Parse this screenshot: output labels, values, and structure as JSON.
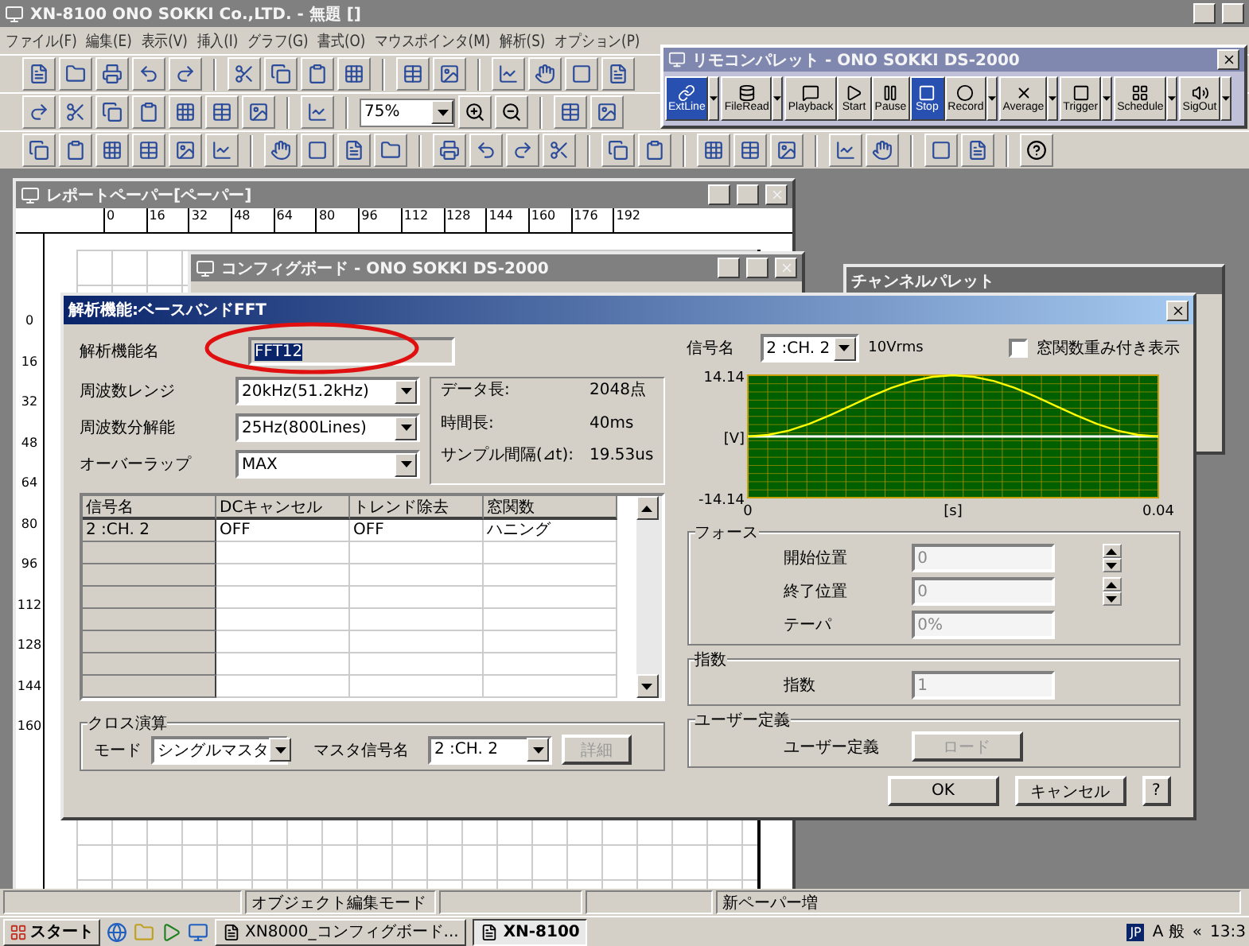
{
  "app": {
    "title": "XN-8100 ONO SOKKI Co.,LTD. - 無題 []",
    "menu": [
      "ファイル(F)",
      "編集(E)",
      "表示(V)",
      "挿入(I)",
      "グラフ(G)",
      "書式(O)",
      "マウスポインタ(M)",
      "解析(S)",
      "オプション(P)"
    ]
  },
  "toolbar": {
    "zoom": "75%"
  },
  "remote_palette": {
    "title": "リモコンパレット - ONO SOKKI DS-2000",
    "buttons": [
      {
        "label": "ExtLine",
        "kind": "link",
        "selected": true,
        "dropdown": true
      },
      {
        "label": "FileRead",
        "kind": "file",
        "selected": false,
        "dropdown": true
      },
      {
        "label": "Playback",
        "kind": "playback",
        "selected": false,
        "dropdown": false
      },
      {
        "label": "Start",
        "kind": "play",
        "selected": false,
        "dropdown": false
      },
      {
        "label": "Pause",
        "kind": "pause",
        "selected": false,
        "dropdown": false
      },
      {
        "label": "Stop",
        "kind": "stop",
        "selected": true,
        "dropdown": false
      },
      {
        "label": "Record",
        "kind": "record",
        "selected": false,
        "dropdown": true
      },
      {
        "label": "Average",
        "kind": "average",
        "selected": false,
        "dropdown": true
      },
      {
        "label": "Trigger",
        "kind": "trigger",
        "selected": false,
        "dropdown": true
      },
      {
        "label": "Schedule",
        "kind": "schedule",
        "selected": false,
        "dropdown": true
      },
      {
        "label": "SigOut",
        "kind": "sigout",
        "selected": false,
        "dropdown": true
      }
    ]
  },
  "report_paper": {
    "title": "レポートペーパー[ペーパー]",
    "ruler": [
      "0",
      "16",
      "32",
      "48",
      "64",
      "80",
      "96",
      "112",
      "128",
      "144",
      "160",
      "176",
      "192"
    ],
    "vertical_ruler": [
      "0",
      "16",
      "32",
      "48",
      "64",
      "80",
      "96",
      "112",
      "128",
      "144",
      "160"
    ]
  },
  "config_board": {
    "title": "コンフィグボード - ONO SOKKI DS-2000"
  },
  "channel_palette": {
    "title": "チャンネルパレット"
  },
  "dialog": {
    "title": "解析機能:ベースバンドFFT",
    "name_label": "解析機能名",
    "name_value": "FFT12",
    "fields": [
      {
        "label": "周波数レンジ",
        "value": "20kHz(51.2kHz)"
      },
      {
        "label": "周波数分解能",
        "value": "25Hz(800Lines)"
      },
      {
        "label": "オーバーラップ",
        "value": "MAX"
      }
    ],
    "info": [
      {
        "label": "データ長:",
        "value": "2048点"
      },
      {
        "label": "時間長:",
        "value": "40ms"
      },
      {
        "label": "サンプル間隔(⊿t):",
        "value": "19.53us"
      }
    ],
    "table": {
      "columns": [
        "信号名",
        "DCキャンセル",
        "トレンド除去",
        "窓関数"
      ],
      "rows": [
        [
          "2 :CH. 2",
          "OFF",
          "OFF",
          "ハニング"
        ]
      ]
    },
    "cross": {
      "title": "クロス演算",
      "mode_label": "モード",
      "mode": "シングルマスタ",
      "master_label": "マスタ信号名",
      "master": "2 :CH. 2",
      "detail": "詳細",
      "detail_disabled": true
    },
    "signal_label": "信号名",
    "signal": "2 :CH. 2",
    "unit": "10Vrms",
    "weight": {
      "label": "窓関数重み付き表示",
      "checked": false
    },
    "chart_data": {
      "type": "line",
      "xlabel": "[s]",
      "ylabel": "[V]",
      "x": [
        0,
        0.002,
        0.004,
        0.006,
        0.008,
        0.01,
        0.012,
        0.014,
        0.016,
        0.018,
        0.02,
        0.022,
        0.024,
        0.026,
        0.028,
        0.03,
        0.032,
        0.034,
        0.036,
        0.038,
        0.04
      ],
      "series": [
        {
          "color": "#ffff00",
          "values": [
            0,
            0.35,
            1.35,
            2.91,
            4.89,
            7.07,
            9.25,
            11.23,
            12.79,
            13.79,
            14.14,
            13.79,
            12.79,
            11.23,
            9.25,
            7.07,
            4.89,
            2.91,
            1.35,
            0.35,
            0
          ]
        }
      ],
      "xlim": [
        0,
        0.04
      ],
      "ylim": [
        -14.14,
        14.14
      ],
      "xticks": [
        {
          "value": 0,
          "label": "0"
        },
        {
          "value": 0.04,
          "label": "0.04"
        }
      ],
      "yticks": [
        {
          "value": -14.14,
          "label": "-14.14"
        },
        {
          "value": 14.14,
          "label": "14.14"
        }
      ]
    },
    "force": {
      "title": "フォース",
      "fields": [
        {
          "label": "開始位置",
          "value": "0",
          "spin": true,
          "disabled": true
        },
        {
          "label": "終了位置",
          "value": "0",
          "spin": true,
          "disabled": true
        },
        {
          "label": "テーパ",
          "value": "0%",
          "spin": false,
          "disabled": true
        }
      ]
    },
    "exponent": {
      "title": "指数",
      "label": "指数",
      "value": "1",
      "disabled": true
    },
    "user": {
      "title": "ユーザー定義",
      "label": "ユーザー定義",
      "button": "ロード",
      "disabled": true
    },
    "buttons": [
      "OK",
      "キャンセル"
    ],
    "help": "?"
  },
  "status_bar": [
    "オブジェクト編集モード",
    "新ペーパー増"
  ],
  "taskbar": {
    "start": "スタート",
    "tasks": [
      {
        "label": "XN8000_コンフィグボード...",
        "selected": false
      },
      {
        "label": "XN-8100",
        "selected": true
      }
    ],
    "ime": "JP",
    "ime_mode": "A 般",
    "chevron": "«",
    "clock": "13:3"
  }
}
